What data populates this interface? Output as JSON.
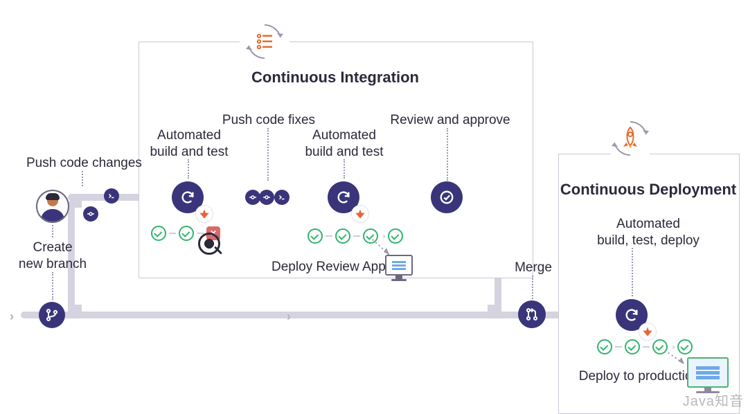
{
  "colors": {
    "primary": "#3a357a",
    "pipe": "#d6d3e0",
    "success": "#30b46c",
    "fail": "#d96a6a"
  },
  "icons": {
    "avatar": "user-avatar-icon",
    "branch": "git-branch-icon",
    "terminal": "terminal-icon",
    "cycle": "refresh-cycle-icon",
    "check": "check-circle-icon",
    "merge": "merge-request-icon",
    "runner": "gitlab-runner-icon",
    "bug": "bug-magnifier-icon",
    "rocket": "rocket-icon",
    "monitor": "monitor-icon",
    "checklist": "checklist-icon"
  },
  "ci_panel": {
    "title": "Continuous Integration"
  },
  "cd_panel": {
    "title": "Continuous Deployment"
  },
  "steps": {
    "create_branch": "Create\nnew branch",
    "push_changes": "Push code changes",
    "build_test_1": "Automated\nbuild and test",
    "push_fixes": "Push code fixes",
    "build_test_2": "Automated\nbuild and test",
    "review": "Review and approve",
    "deploy_review_app": "Deploy Review App",
    "merge": "Merge",
    "auto_deploy": "Automated\nbuild, test, deploy",
    "deploy_prod": "Deploy to production"
  },
  "watermark": "Java知音"
}
